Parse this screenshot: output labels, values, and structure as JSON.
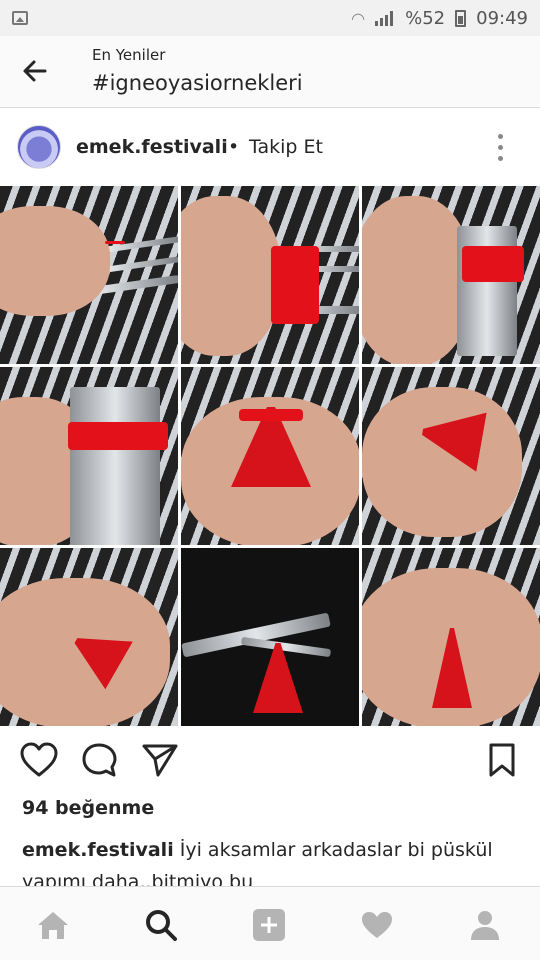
{
  "status_bar": {
    "battery_text": "%52",
    "time": "09:49"
  },
  "header": {
    "subtitle": "En Yeniler",
    "title": "#igneoyasiornekleri"
  },
  "post": {
    "username": "emek.festivali",
    "separator": "•",
    "follow_label": "Takip Et",
    "likes": "94 beğenme",
    "caption_username": "emek.festivali",
    "caption_text": "İyi aksamlar arkadaslar bi püskül yapımı daha..bitmiyo bu"
  },
  "icons": {
    "back": "arrow-left-icon",
    "more": "more-vertical-icon",
    "like": "heart-outline-icon",
    "comment": "comment-bubble-icon",
    "share": "send-paper-plane-icon",
    "save": "bookmark-icon",
    "nav": [
      "home-icon",
      "search-icon",
      "add-post-icon",
      "activity-heart-icon",
      "profile-icon"
    ]
  },
  "colors": {
    "thread": "#e3121a",
    "nav_active": "#262626",
    "nav_inactive": "#b4b4b4"
  }
}
